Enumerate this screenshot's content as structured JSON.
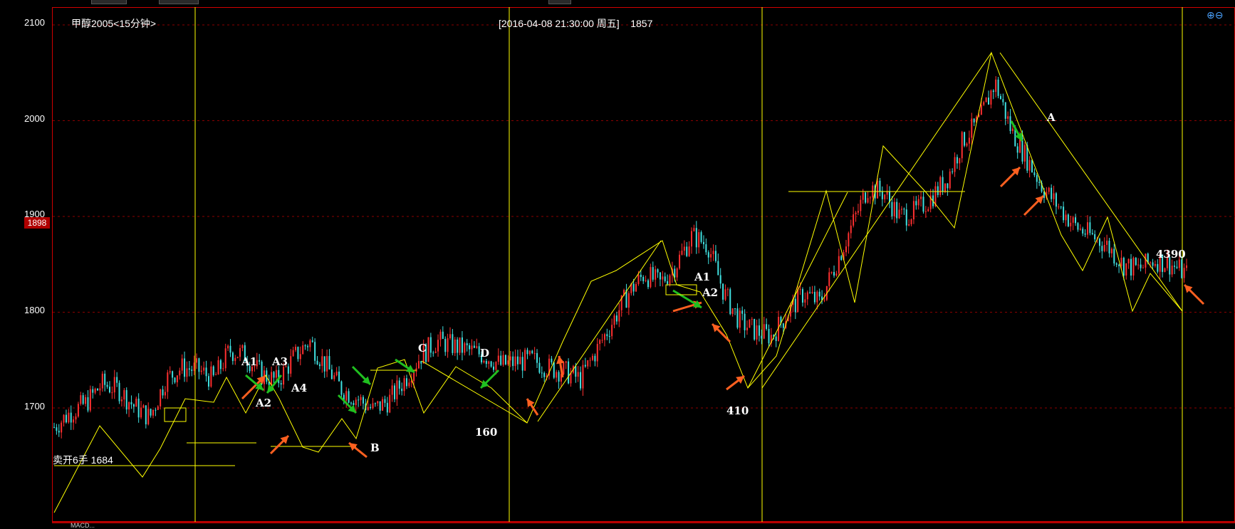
{
  "window": {
    "symbol_title": "甲醇2005<15分钟>",
    "cursor_time": "[2016-04-08  21:30:00 周五]",
    "cursor_price": "1857",
    "zoom_icons": "⊕⊖"
  },
  "axis": {
    "y_labels": [
      "2100",
      "2000",
      "1900",
      "1800",
      "1700"
    ],
    "current_price": "1898"
  },
  "position_label": "卖开6手 1684",
  "annotations": {
    "a1_left": "A1",
    "a2_left": "A2",
    "a3_left": "A3",
    "a4_left": "A4",
    "b": "B",
    "c": "C",
    "d": "D",
    "a1_mid": "A1",
    "a2_mid": "A2",
    "a_right": "A",
    "n160": "160",
    "n410": "410",
    "n4390": "4390"
  },
  "bottom_text": "MACD...",
  "colors": {
    "background": "#000000",
    "up_candle": "#ff3030",
    "down_candle": "#40e0e0",
    "trend_lines": "#ffff00",
    "separators": "#ffff00",
    "grid": "#8b0000",
    "buy_arrow": "#ff6020",
    "sell_arrow": "#20c020"
  },
  "chart_data": {
    "type": "candlestick",
    "y_range": [
      1640,
      2120
    ],
    "price_path": [
      [
        0,
        1680
      ],
      [
        20,
        1695
      ],
      [
        40,
        1705
      ],
      [
        60,
        1725
      ],
      [
        80,
        1720
      ],
      [
        100,
        1702
      ],
      [
        120,
        1690
      ],
      [
        140,
        1730
      ],
      [
        160,
        1742
      ],
      [
        180,
        1740
      ],
      [
        200,
        1730
      ],
      [
        220,
        1760
      ],
      [
        240,
        1755
      ],
      [
        260,
        1735
      ],
      [
        280,
        1728
      ],
      [
        300,
        1752
      ],
      [
        320,
        1770
      ],
      [
        340,
        1745
      ],
      [
        360,
        1720
      ],
      [
        380,
        1710
      ],
      [
        400,
        1698
      ],
      [
        420,
        1708
      ],
      [
        440,
        1730
      ],
      [
        460,
        1755
      ],
      [
        480,
        1770
      ],
      [
        500,
        1765
      ],
      [
        520,
        1760
      ],
      [
        540,
        1755
      ],
      [
        560,
        1745
      ],
      [
        580,
        1748
      ],
      [
        600,
        1750
      ],
      [
        620,
        1742
      ],
      [
        640,
        1738
      ],
      [
        660,
        1730
      ],
      [
        680,
        1760
      ],
      [
        700,
        1790
      ],
      [
        720,
        1820
      ],
      [
        740,
        1840
      ],
      [
        760,
        1830
      ],
      [
        780,
        1850
      ],
      [
        800,
        1880
      ],
      [
        820,
        1870
      ],
      [
        840,
        1820
      ],
      [
        860,
        1790
      ],
      [
        880,
        1780
      ],
      [
        900,
        1775
      ],
      [
        920,
        1800
      ],
      [
        940,
        1820
      ],
      [
        960,
        1810
      ],
      [
        980,
        1850
      ],
      [
        1000,
        1890
      ],
      [
        1020,
        1930
      ],
      [
        1040,
        1925
      ],
      [
        1060,
        1900
      ],
      [
        1080,
        1905
      ],
      [
        1100,
        1920
      ],
      [
        1120,
        1940
      ],
      [
        1140,
        1980
      ],
      [
        1160,
        2000
      ],
      [
        1180,
        2040
      ],
      [
        1200,
        1990
      ],
      [
        1220,
        1960
      ],
      [
        1240,
        1930
      ],
      [
        1260,
        1910
      ],
      [
        1280,
        1890
      ],
      [
        1300,
        1880
      ],
      [
        1320,
        1870
      ],
      [
        1340,
        1850
      ],
      [
        1360,
        1845
      ],
      [
        1380,
        1855
      ],
      [
        1400,
        1850
      ],
      [
        1420,
        1840
      ]
    ]
  }
}
